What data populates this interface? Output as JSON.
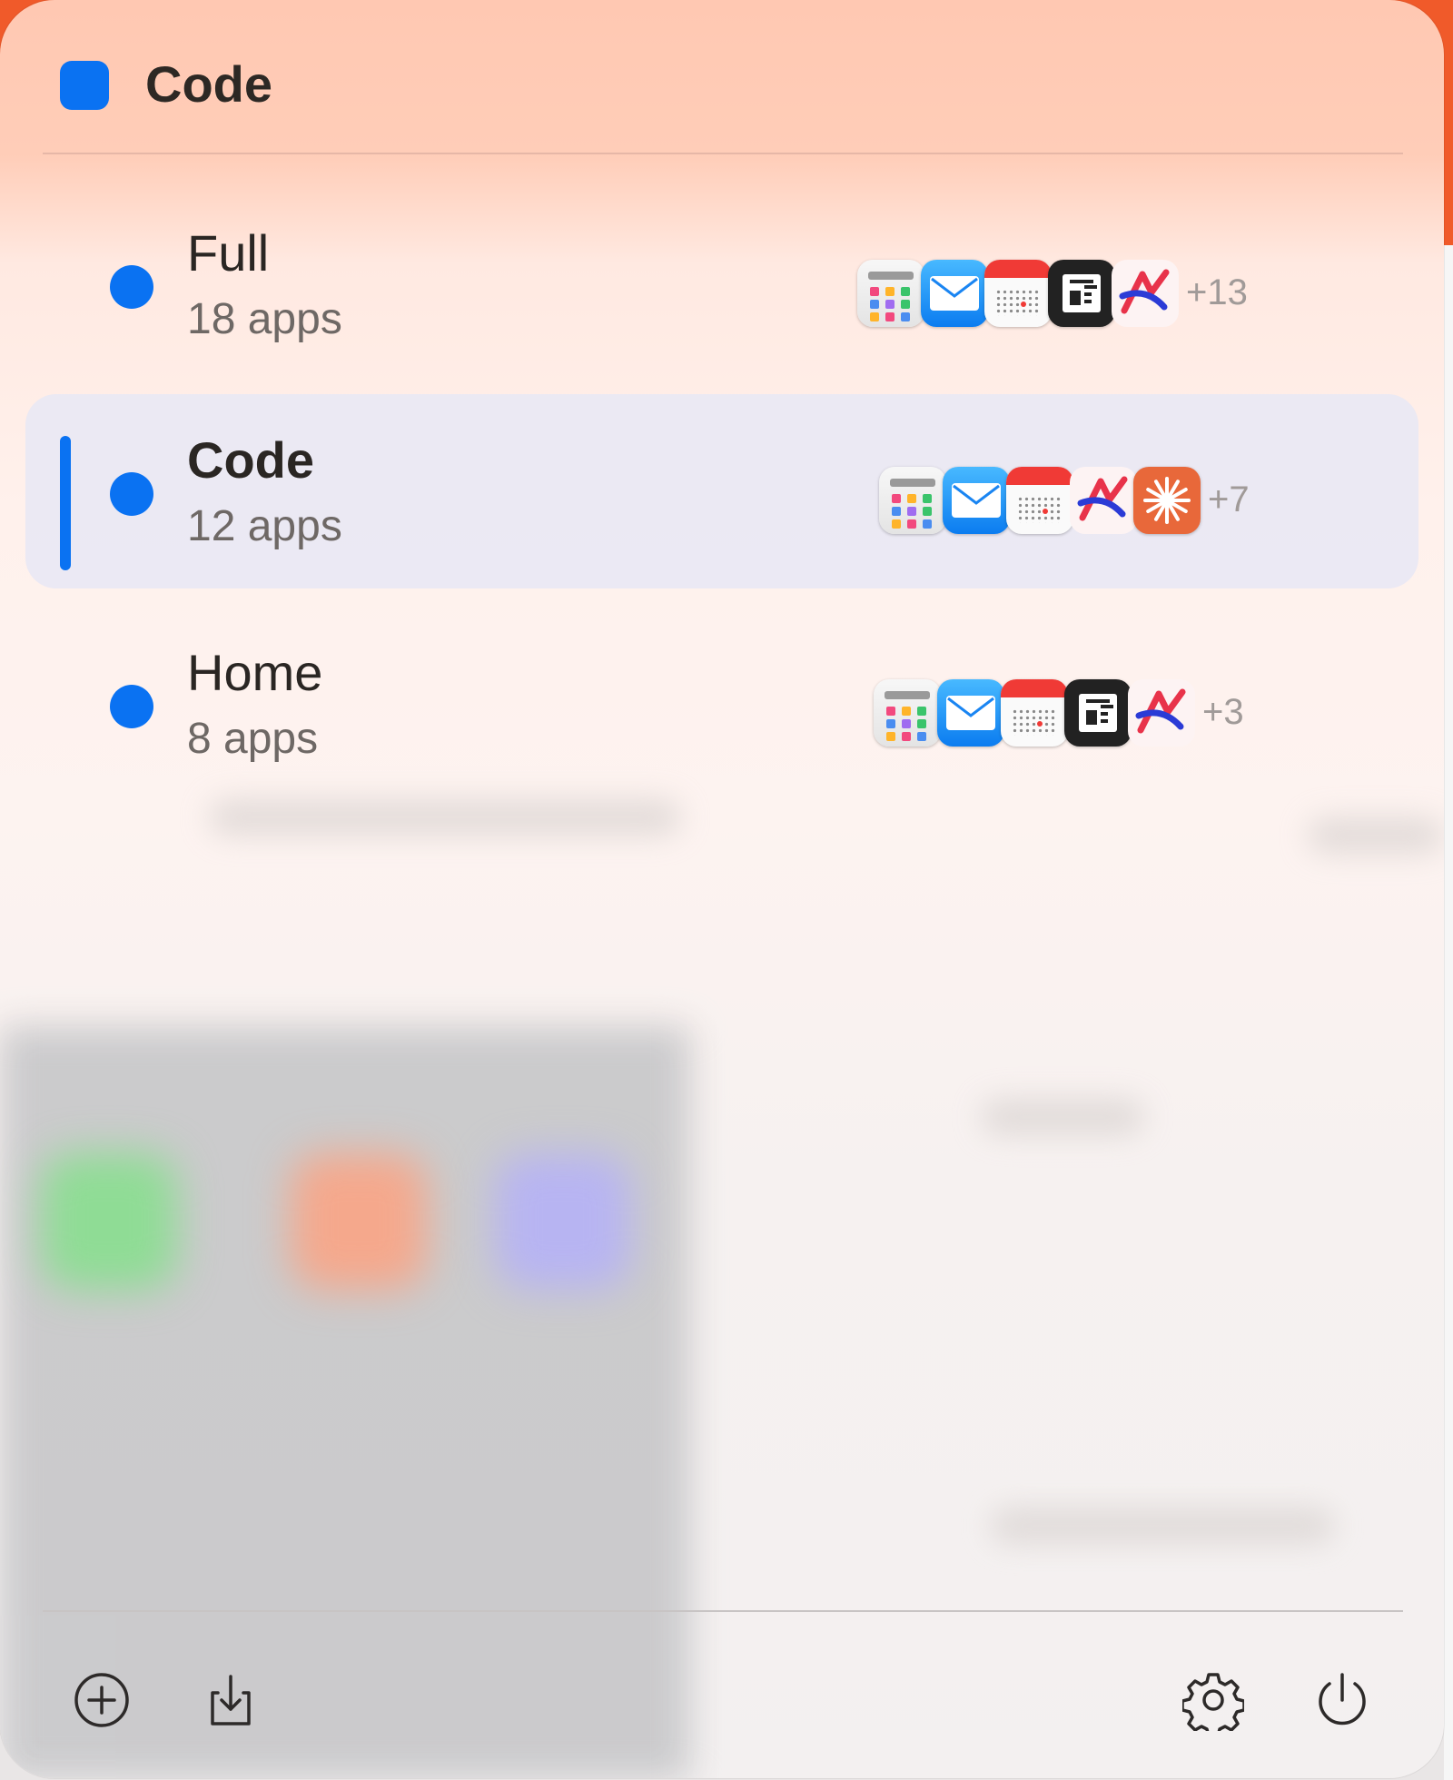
{
  "header": {
    "title": "Code",
    "accent_color": "#0a72f2"
  },
  "profiles": [
    {
      "name": "Full",
      "count": "18 apps",
      "more": "+13",
      "selected": false,
      "icons": [
        "launchpad-icon",
        "mail-icon",
        "calendar-icon",
        "news-icon",
        "arc-icon"
      ]
    },
    {
      "name": "Code",
      "count": "12 apps",
      "more": "+7",
      "selected": true,
      "icons": [
        "launchpad-icon",
        "mail-icon",
        "calendar-icon",
        "arc-icon",
        "claude-icon"
      ]
    },
    {
      "name": "Home",
      "count": "8 apps",
      "more": "+3",
      "selected": false,
      "icons": [
        "launchpad-icon",
        "mail-icon",
        "calendar-icon",
        "news-icon",
        "arc-icon"
      ]
    }
  ],
  "footer": {
    "add": "plus-circle-icon",
    "import": "import-icon",
    "settings": "gear-icon",
    "power": "power-icon"
  }
}
